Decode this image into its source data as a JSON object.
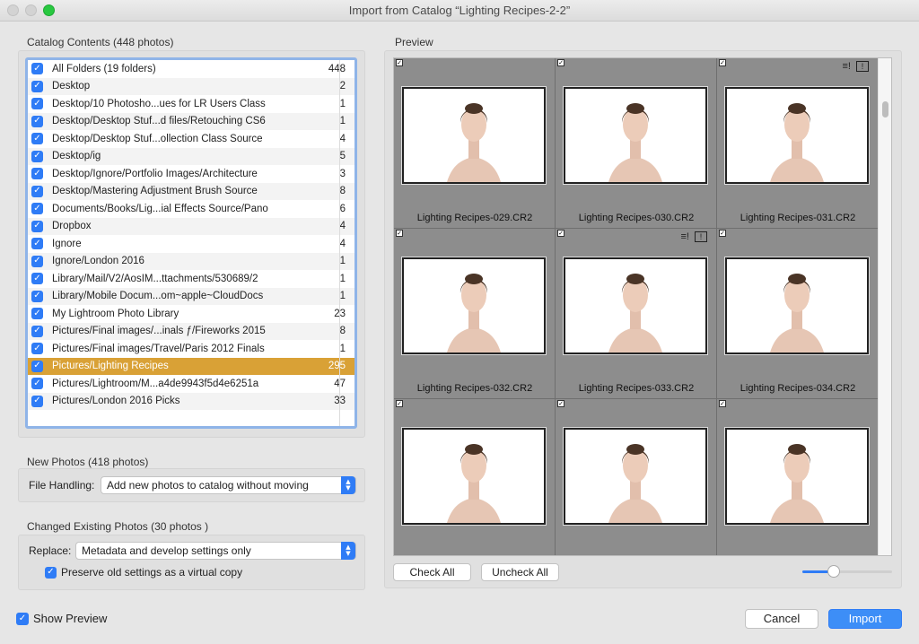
{
  "window": {
    "title": "Import from Catalog “Lighting Recipes-2-2”"
  },
  "catalog": {
    "label": "Catalog Contents (448 photos)",
    "rows": [
      {
        "name": "All Folders (19 folders)",
        "count": "448",
        "checked": true
      },
      {
        "name": "Desktop",
        "count": "2",
        "checked": true
      },
      {
        "name": "Desktop/10 Photosho...ues for LR Users Class",
        "count": "1",
        "checked": true
      },
      {
        "name": "Desktop/Desktop Stuf...d files/Retouching CS6",
        "count": "1",
        "checked": true
      },
      {
        "name": "Desktop/Desktop Stuf...ollection Class Source",
        "count": "4",
        "checked": true
      },
      {
        "name": "Desktop/ig",
        "count": "5",
        "checked": true
      },
      {
        "name": "Desktop/Ignore/Portfolio Images/Architecture",
        "count": "3",
        "checked": true
      },
      {
        "name": "Desktop/Mastering Adjustment Brush Source",
        "count": "8",
        "checked": true
      },
      {
        "name": "Documents/Books/Lig...ial Effects Source/Pano",
        "count": "6",
        "checked": true
      },
      {
        "name": "Dropbox",
        "count": "4",
        "checked": true
      },
      {
        "name": "Ignore",
        "count": "4",
        "checked": true
      },
      {
        "name": "Ignore/London 2016",
        "count": "1",
        "checked": true
      },
      {
        "name": "Library/Mail/V2/AosIM...ttachments/530689/2",
        "count": "1",
        "checked": true
      },
      {
        "name": "Library/Mobile Docum...om~apple~CloudDocs",
        "count": "1",
        "checked": true
      },
      {
        "name": "My Lightroom Photo Library",
        "count": "23",
        "checked": true
      },
      {
        "name": "Pictures/Final images/...inals ƒ/Fireworks 2015",
        "count": "8",
        "checked": true
      },
      {
        "name": "Pictures/Final images/Travel/Paris 2012 Finals",
        "count": "1",
        "checked": true
      },
      {
        "name": "Pictures/Lighting Recipes",
        "count": "295",
        "checked": true,
        "selected": true
      },
      {
        "name": "Pictures/Lightroom/M...a4de9943f5d4e6251a",
        "count": "47",
        "checked": true
      },
      {
        "name": "Pictures/London 2016 Picks",
        "count": "33",
        "checked": true
      }
    ]
  },
  "new_photos": {
    "label": "New Photos (418 photos)",
    "file_handling_label": "File Handling:",
    "file_handling_value": "Add new photos to catalog without moving"
  },
  "changed_photos": {
    "label": "Changed Existing Photos (30 photos )",
    "replace_label": "Replace:",
    "replace_value": "Metadata and develop settings only",
    "preserve_label": "Preserve old settings as a virtual copy",
    "preserve_checked": true
  },
  "preview": {
    "label": "Preview",
    "photos": [
      {
        "name": "Lighting Recipes-029.CR2",
        "badges": false
      },
      {
        "name": "Lighting Recipes-030.CR2",
        "badges": false
      },
      {
        "name": "Lighting Recipes-031.CR2",
        "badges": true
      },
      {
        "name": "Lighting Recipes-032.CR2",
        "badges": false
      },
      {
        "name": "Lighting Recipes-033.CR2",
        "badges": true
      },
      {
        "name": "Lighting Recipes-034.CR2",
        "badges": false
      },
      {
        "name": "",
        "badges": false
      },
      {
        "name": "",
        "badges": false
      },
      {
        "name": "",
        "badges": false
      }
    ],
    "check_all": "Check All",
    "uncheck_all": "Uncheck All",
    "thumb_size": 0.35
  },
  "footer": {
    "show_preview_label": "Show Preview",
    "show_preview_checked": true,
    "cancel": "Cancel",
    "import": "Import"
  },
  "colors": {
    "accent": "#2f7cf6",
    "selected_row": "#d9a136",
    "grid_bg": "#8d8d8d"
  },
  "icons": {
    "check": "checkmark-icon",
    "metadata": "metadata-badge-icon",
    "develop": "develop-badge-icon"
  }
}
